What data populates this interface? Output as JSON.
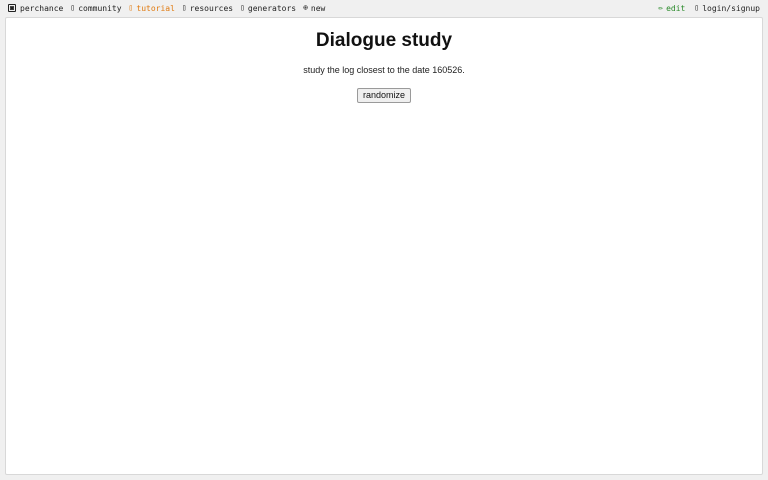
{
  "nav": {
    "left": [
      {
        "icon": "dice-icon",
        "label": "perchance"
      },
      {
        "icon": "people-icon",
        "glyph": "▯",
        "label": "community"
      },
      {
        "icon": "book-icon",
        "glyph": "▯",
        "label": "tutorial"
      },
      {
        "icon": "box-icon",
        "glyph": "▯",
        "label": "resources"
      },
      {
        "icon": "grid-icon",
        "glyph": "▯",
        "label": "generators"
      },
      {
        "icon": "plus-circle-icon",
        "glyph": "⊕",
        "label": "new"
      }
    ],
    "right": [
      {
        "icon": "pencil-icon",
        "glyph": "✏",
        "label": "edit"
      },
      {
        "icon": "user-icon",
        "glyph": "▯",
        "label": "login/signup"
      }
    ]
  },
  "colors": {
    "tutorial": "#e07a10",
    "edit": "#2a8a2a"
  },
  "page": {
    "title": "Dialogue study",
    "output": "study the log closest to the date 160526.",
    "button_label": "randomize"
  }
}
